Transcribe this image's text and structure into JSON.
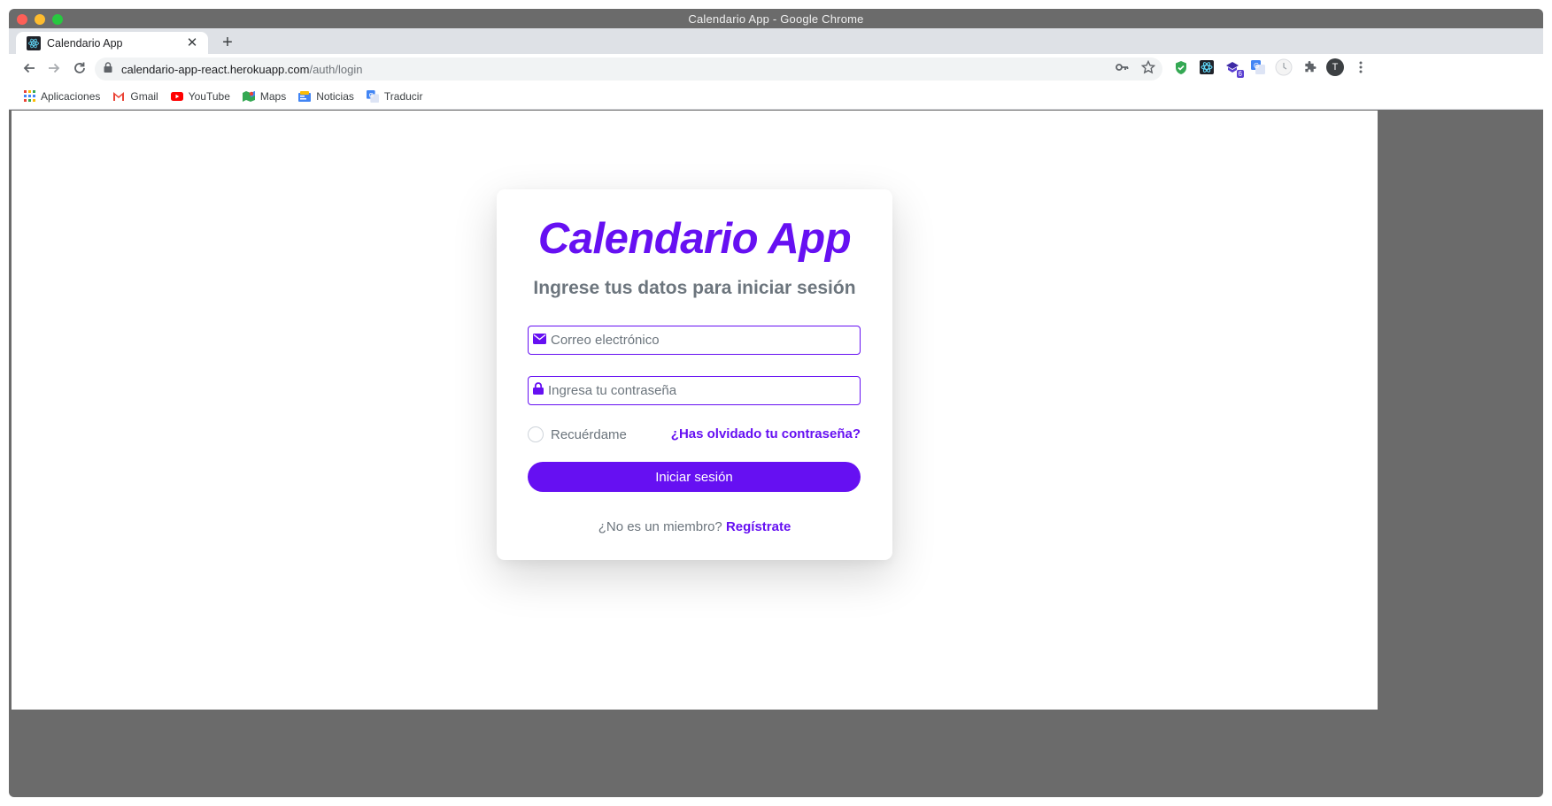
{
  "window": {
    "title": "Calendario App - Google Chrome"
  },
  "tab": {
    "title": "Calendario App",
    "close": "✕",
    "new_tab": "+"
  },
  "address_bar": {
    "host": "calendario-app-react.herokuapp.com",
    "path": "/auth/login"
  },
  "profile": {
    "initial": "T"
  },
  "extensions": {
    "badge": "6"
  },
  "bookmarks": [
    {
      "label": "Aplicaciones",
      "icon": "apps-grid-icon"
    },
    {
      "label": "Gmail",
      "icon": "gmail-icon"
    },
    {
      "label": "YouTube",
      "icon": "youtube-icon"
    },
    {
      "label": "Maps",
      "icon": "maps-icon"
    },
    {
      "label": "Noticias",
      "icon": "news-icon"
    },
    {
      "label": "Traducir",
      "icon": "translate-icon"
    }
  ],
  "login": {
    "brand": "Calendario App",
    "subtitle": "Ingrese tus datos para iniciar sesión",
    "email_placeholder": "Correo electrónico",
    "password_placeholder": "Ingresa tu contraseña",
    "remember_label": "Recuérdame",
    "forgot_link": "¿Has olvidado tu contraseña?",
    "submit_label": "Iniciar sesión",
    "register_prompt": "¿No es un miembro?",
    "register_link": "Regístrate"
  },
  "colors": {
    "accent": "#6610f2",
    "muted_text": "#6c757d"
  }
}
